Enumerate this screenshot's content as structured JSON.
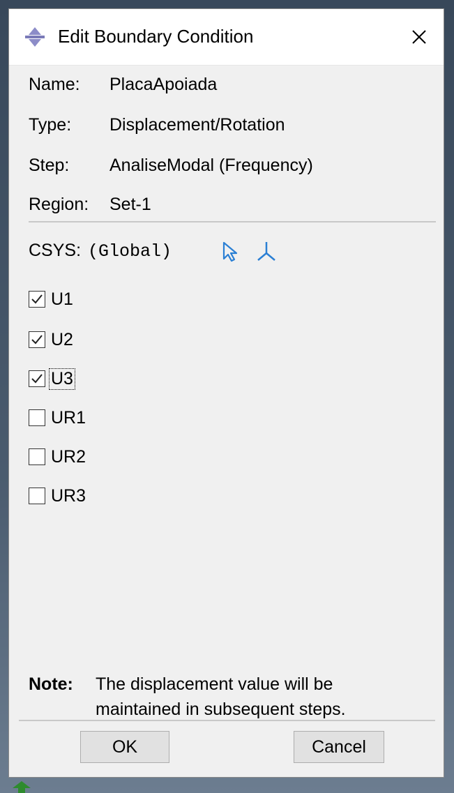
{
  "window": {
    "title": "Edit Boundary Condition",
    "close_label": "×"
  },
  "fields": [
    {
      "label": "Name:",
      "value": "PlacaApoiada"
    },
    {
      "label": "Type:",
      "value": "Displacement/Rotation"
    },
    {
      "label": "Step:",
      "value": "AnaliseModal (Frequency)"
    },
    {
      "label": "Region:",
      "value": "Set-1"
    }
  ],
  "csys": {
    "label": "CSYS:",
    "value": "(Global)",
    "icons": [
      "select-arrow-icon",
      "axis-triad-icon"
    ]
  },
  "dofs": [
    {
      "label": "U1",
      "checked": true
    },
    {
      "label": "U2",
      "checked": true
    },
    {
      "label": "U3",
      "checked": true,
      "focused": true
    },
    {
      "label": "UR1",
      "checked": false
    },
    {
      "label": "UR2",
      "checked": false
    },
    {
      "label": "UR3",
      "checked": false
    }
  ],
  "note": {
    "label": "Note:",
    "line1": "The displacement value will be",
    "line2": "maintained in subsequent steps."
  },
  "buttons": {
    "ok": "OK",
    "cancel": "Cancel"
  },
  "colors": {
    "accent": "#2a7fd4",
    "dialog_bg": "#f0f0f0",
    "button_bg": "#e1e1e1"
  }
}
